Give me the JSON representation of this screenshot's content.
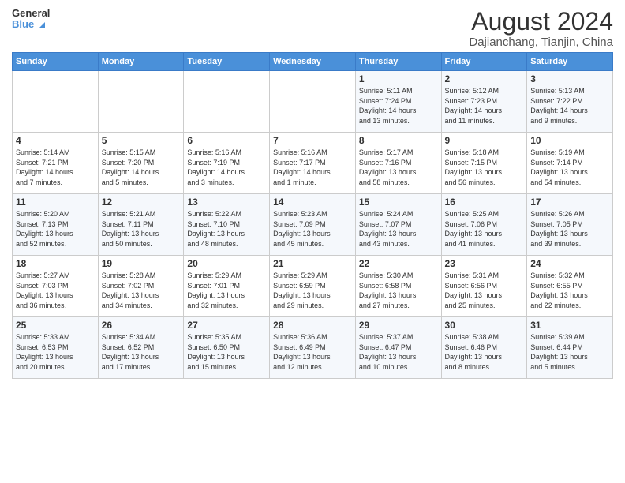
{
  "header": {
    "logo_line1": "General",
    "logo_line2": "Blue",
    "month_year": "August 2024",
    "location": "Dajianchang, Tianjin, China"
  },
  "days_of_week": [
    "Sunday",
    "Monday",
    "Tuesday",
    "Wednesday",
    "Thursday",
    "Friday",
    "Saturday"
  ],
  "weeks": [
    [
      {
        "day": "",
        "info": ""
      },
      {
        "day": "",
        "info": ""
      },
      {
        "day": "",
        "info": ""
      },
      {
        "day": "",
        "info": ""
      },
      {
        "day": "1",
        "info": "Sunrise: 5:11 AM\nSunset: 7:24 PM\nDaylight: 14 hours\nand 13 minutes."
      },
      {
        "day": "2",
        "info": "Sunrise: 5:12 AM\nSunset: 7:23 PM\nDaylight: 14 hours\nand 11 minutes."
      },
      {
        "day": "3",
        "info": "Sunrise: 5:13 AM\nSunset: 7:22 PM\nDaylight: 14 hours\nand 9 minutes."
      }
    ],
    [
      {
        "day": "4",
        "info": "Sunrise: 5:14 AM\nSunset: 7:21 PM\nDaylight: 14 hours\nand 7 minutes."
      },
      {
        "day": "5",
        "info": "Sunrise: 5:15 AM\nSunset: 7:20 PM\nDaylight: 14 hours\nand 5 minutes."
      },
      {
        "day": "6",
        "info": "Sunrise: 5:16 AM\nSunset: 7:19 PM\nDaylight: 14 hours\nand 3 minutes."
      },
      {
        "day": "7",
        "info": "Sunrise: 5:16 AM\nSunset: 7:17 PM\nDaylight: 14 hours\nand 1 minute."
      },
      {
        "day": "8",
        "info": "Sunrise: 5:17 AM\nSunset: 7:16 PM\nDaylight: 13 hours\nand 58 minutes."
      },
      {
        "day": "9",
        "info": "Sunrise: 5:18 AM\nSunset: 7:15 PM\nDaylight: 13 hours\nand 56 minutes."
      },
      {
        "day": "10",
        "info": "Sunrise: 5:19 AM\nSunset: 7:14 PM\nDaylight: 13 hours\nand 54 minutes."
      }
    ],
    [
      {
        "day": "11",
        "info": "Sunrise: 5:20 AM\nSunset: 7:13 PM\nDaylight: 13 hours\nand 52 minutes."
      },
      {
        "day": "12",
        "info": "Sunrise: 5:21 AM\nSunset: 7:11 PM\nDaylight: 13 hours\nand 50 minutes."
      },
      {
        "day": "13",
        "info": "Sunrise: 5:22 AM\nSunset: 7:10 PM\nDaylight: 13 hours\nand 48 minutes."
      },
      {
        "day": "14",
        "info": "Sunrise: 5:23 AM\nSunset: 7:09 PM\nDaylight: 13 hours\nand 45 minutes."
      },
      {
        "day": "15",
        "info": "Sunrise: 5:24 AM\nSunset: 7:07 PM\nDaylight: 13 hours\nand 43 minutes."
      },
      {
        "day": "16",
        "info": "Sunrise: 5:25 AM\nSunset: 7:06 PM\nDaylight: 13 hours\nand 41 minutes."
      },
      {
        "day": "17",
        "info": "Sunrise: 5:26 AM\nSunset: 7:05 PM\nDaylight: 13 hours\nand 39 minutes."
      }
    ],
    [
      {
        "day": "18",
        "info": "Sunrise: 5:27 AM\nSunset: 7:03 PM\nDaylight: 13 hours\nand 36 minutes."
      },
      {
        "day": "19",
        "info": "Sunrise: 5:28 AM\nSunset: 7:02 PM\nDaylight: 13 hours\nand 34 minutes."
      },
      {
        "day": "20",
        "info": "Sunrise: 5:29 AM\nSunset: 7:01 PM\nDaylight: 13 hours\nand 32 minutes."
      },
      {
        "day": "21",
        "info": "Sunrise: 5:29 AM\nSunset: 6:59 PM\nDaylight: 13 hours\nand 29 minutes."
      },
      {
        "day": "22",
        "info": "Sunrise: 5:30 AM\nSunset: 6:58 PM\nDaylight: 13 hours\nand 27 minutes."
      },
      {
        "day": "23",
        "info": "Sunrise: 5:31 AM\nSunset: 6:56 PM\nDaylight: 13 hours\nand 25 minutes."
      },
      {
        "day": "24",
        "info": "Sunrise: 5:32 AM\nSunset: 6:55 PM\nDaylight: 13 hours\nand 22 minutes."
      }
    ],
    [
      {
        "day": "25",
        "info": "Sunrise: 5:33 AM\nSunset: 6:53 PM\nDaylight: 13 hours\nand 20 minutes."
      },
      {
        "day": "26",
        "info": "Sunrise: 5:34 AM\nSunset: 6:52 PM\nDaylight: 13 hours\nand 17 minutes."
      },
      {
        "day": "27",
        "info": "Sunrise: 5:35 AM\nSunset: 6:50 PM\nDaylight: 13 hours\nand 15 minutes."
      },
      {
        "day": "28",
        "info": "Sunrise: 5:36 AM\nSunset: 6:49 PM\nDaylight: 13 hours\nand 12 minutes."
      },
      {
        "day": "29",
        "info": "Sunrise: 5:37 AM\nSunset: 6:47 PM\nDaylight: 13 hours\nand 10 minutes."
      },
      {
        "day": "30",
        "info": "Sunrise: 5:38 AM\nSunset: 6:46 PM\nDaylight: 13 hours\nand 8 minutes."
      },
      {
        "day": "31",
        "info": "Sunrise: 5:39 AM\nSunset: 6:44 PM\nDaylight: 13 hours\nand 5 minutes."
      }
    ]
  ]
}
